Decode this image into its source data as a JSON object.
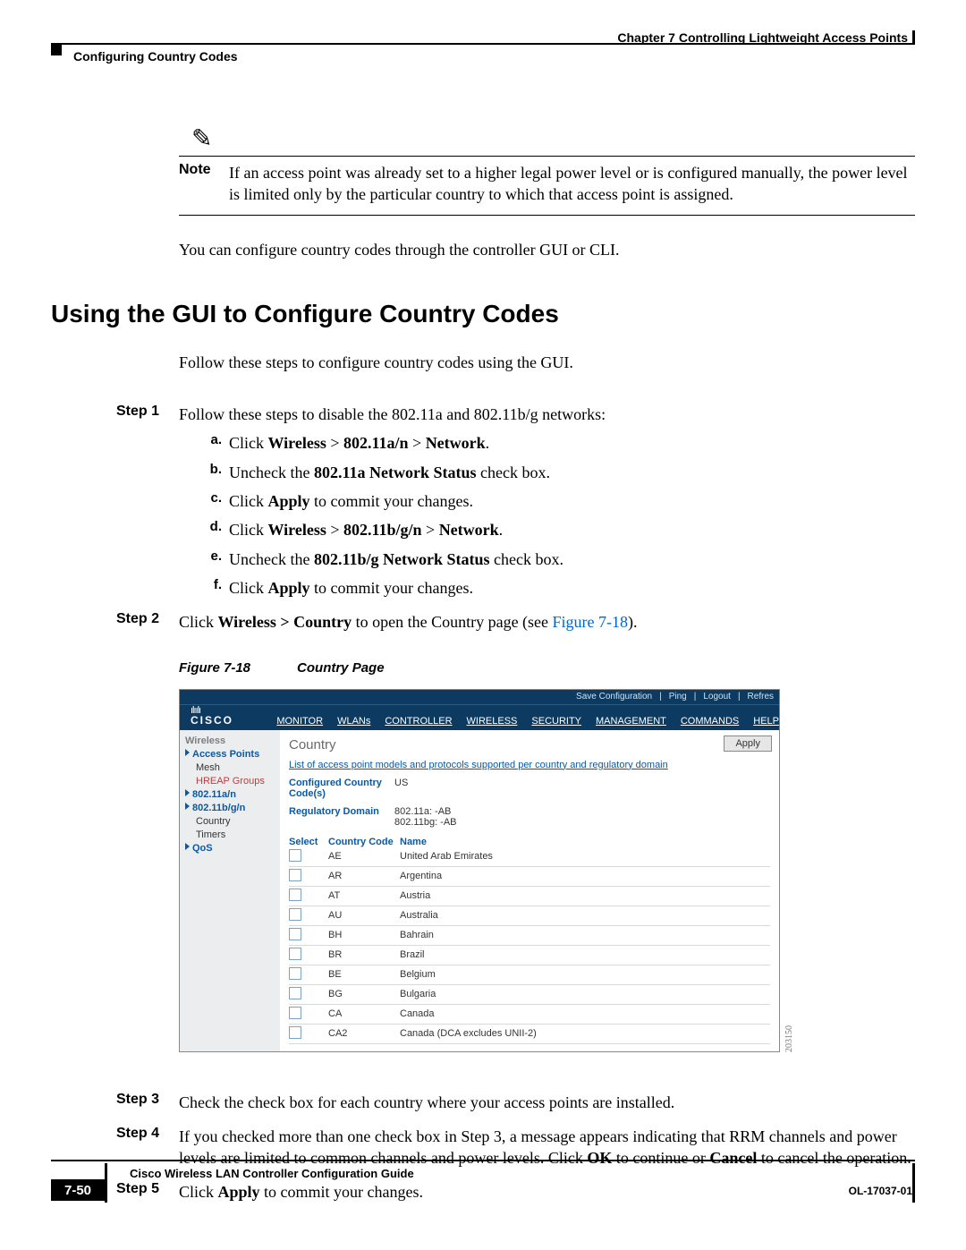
{
  "header": {
    "chapter": "Chapter 7    Controlling Lightweight Access Points",
    "section": "Configuring Country Codes"
  },
  "note": {
    "label": "Note",
    "text": "If an access point was already set to a higher legal power level or is configured manually, the power level is limited only by the particular country to which that access point is assigned."
  },
  "p1": "You can configure country codes through the controller GUI or CLI.",
  "h2": "Using the GUI to Configure Country Codes",
  "p2": "Follow these steps to configure country codes using the GUI.",
  "steps": {
    "s1": {
      "label": "Step 1",
      "text": "Follow these steps to disable the 802.11a and 802.11b/g networks:"
    },
    "s1a": {
      "label": "a.",
      "pre": "Click ",
      "b": "Wireless",
      "gt1": " > ",
      "b2": "802.11a/n",
      "gt2": " > ",
      "b3": "Network",
      "post": "."
    },
    "s1b": {
      "label": "b.",
      "pre": "Uncheck the ",
      "b": "802.11a Network Status",
      "post": " check box."
    },
    "s1c": {
      "label": "c.",
      "pre": "Click ",
      "b": "Apply",
      "post": " to commit your changes."
    },
    "s1d": {
      "label": "d.",
      "pre": "Click ",
      "b": "Wireless",
      "gt1": " > ",
      "b2": "802.11b/g/n",
      "gt2": " > ",
      "b3": "Network",
      "post": "."
    },
    "s1e": {
      "label": "e.",
      "pre": "Uncheck the ",
      "b": "802.11b/g Network Status",
      "post": " check box."
    },
    "s1f": {
      "label": "f.",
      "pre": "Click ",
      "b": "Apply",
      "post": " to commit your changes."
    },
    "s2": {
      "label": "Step 2",
      "pre": "Click ",
      "b": "Wireless > Country",
      "post": " to open the Country page (see ",
      "link": "Figure 7-18",
      "end": ")."
    },
    "s3": {
      "label": "Step 3",
      "text": "Check the check box for each country where your access points are installed."
    },
    "s4": {
      "label": "Step 4",
      "pre": "If you checked more than one check box in Step 3, a message appears indicating that RRM channels and power levels are limited to common channels and power levels. Click ",
      "b1": "OK",
      "mid": " to continue or ",
      "b2": "Cancel",
      "post": " to cancel the operation."
    },
    "s5": {
      "label": "Step 5",
      "pre": "Click ",
      "b": "Apply",
      "post": " to commit your changes."
    }
  },
  "figcap": {
    "a": "Figure 7-18",
    "b": "Country Page"
  },
  "shot": {
    "topbar": {
      "save": "Save Configuration",
      "ping": "Ping",
      "logout": "Logout",
      "refresh": "Refres"
    },
    "logo": {
      "dots": "ılıılı",
      "name": "CISCO"
    },
    "menu": [
      "MONITOR",
      "WLANs",
      "CONTROLLER",
      "WIRELESS",
      "SECURITY",
      "MANAGEMENT",
      "COMMANDS",
      "HELP"
    ],
    "side": {
      "title": "Wireless",
      "ap": "Access Points",
      "mesh": "Mesh",
      "hreap": "HREAP Groups",
      "a": "802.11a/n",
      "b": "802.11b/g/n",
      "country": "Country",
      "timers": "Timers",
      "qos": "QoS"
    },
    "body": {
      "title": "Country",
      "apply": "Apply",
      "link": "List of access point models and protocols supported per country and regulatory domain",
      "cc_label": "Configured Country Code(s)",
      "cc_val": "US",
      "rd_label": "Regulatory Domain",
      "rd_v1": "802.11a:  -AB",
      "rd_v2": "802.11bg: -AB",
      "th": {
        "sel": "Select",
        "code": "Country Code",
        "name": "Name"
      },
      "rows": [
        {
          "code": "AE",
          "name": "United Arab Emirates"
        },
        {
          "code": "AR",
          "name": "Argentina"
        },
        {
          "code": "AT",
          "name": "Austria"
        },
        {
          "code": "AU",
          "name": "Australia"
        },
        {
          "code": "BH",
          "name": "Bahrain"
        },
        {
          "code": "BR",
          "name": "Brazil"
        },
        {
          "code": "BE",
          "name": "Belgium"
        },
        {
          "code": "BG",
          "name": "Bulgaria"
        },
        {
          "code": "CA",
          "name": "Canada"
        },
        {
          "code": "CA2",
          "name": "Canada (DCA excludes UNII-2)"
        }
      ],
      "imgnum": "203150"
    }
  },
  "footer": {
    "title": "Cisco Wireless LAN Controller Configuration Guide",
    "page": "7-50",
    "ol": "OL-17037-01"
  }
}
